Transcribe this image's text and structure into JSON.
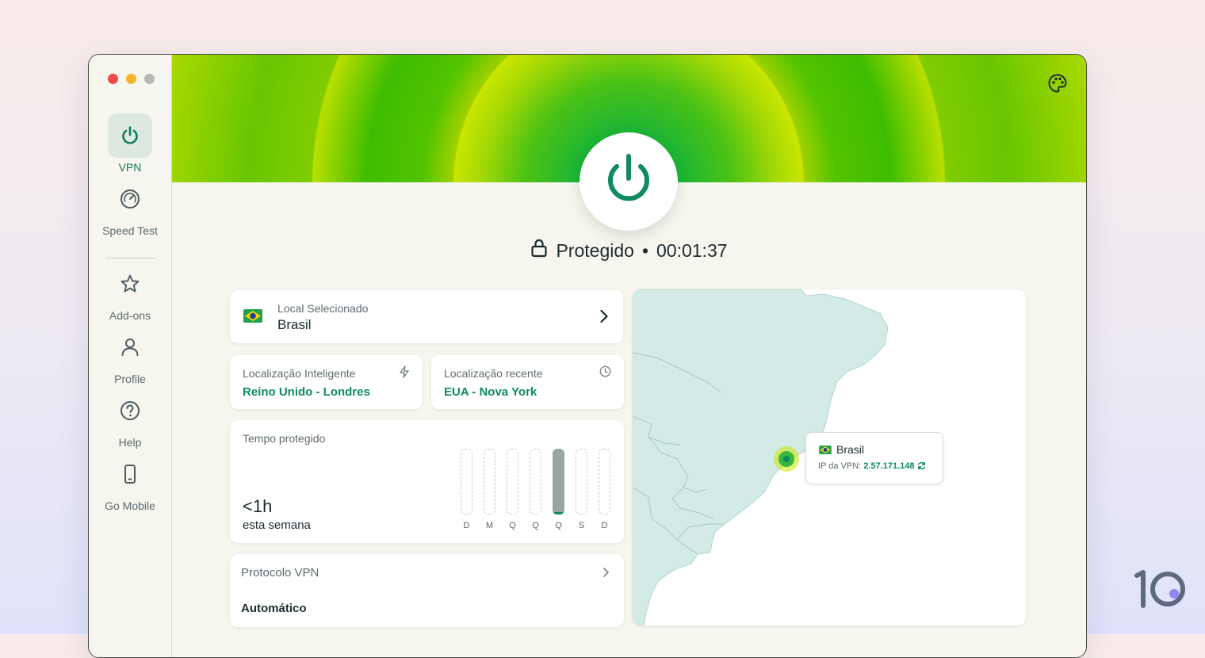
{
  "sidebar": {
    "items": [
      {
        "label": "VPN",
        "icon": "power-icon",
        "active": true
      },
      {
        "label": "Speed Test",
        "icon": "speedometer-icon"
      },
      {
        "label": "Add-ons",
        "icon": "star-icon"
      },
      {
        "label": "Profile",
        "icon": "user-icon"
      },
      {
        "label": "Help",
        "icon": "question-icon"
      },
      {
        "label": "Go Mobile",
        "icon": "phone-icon"
      }
    ]
  },
  "status": {
    "label": "Protegido",
    "separator": "•",
    "timer": "00:01:37"
  },
  "selected_location": {
    "caption": "Local Selecionado",
    "value": "Brasil",
    "flag": "brazil-flag"
  },
  "smart_location": {
    "caption": "Localização Inteligente",
    "value": "Reino Unido - Londres"
  },
  "recent_location": {
    "caption": "Localização recente",
    "value": "EUA - Nova York"
  },
  "protected_time": {
    "caption": "Tempo protegido",
    "value": "<1h",
    "period": "esta semana",
    "days": [
      "D",
      "M",
      "Q",
      "Q",
      "Q",
      "S",
      "D"
    ],
    "active_day_index": 4
  },
  "protocol": {
    "caption": "Protocolo VPN",
    "value": "Automático"
  },
  "map_popup": {
    "country": "Brasil",
    "ip_label": "IP da VPN:",
    "ip": "2.57.171.148"
  },
  "colors": {
    "accent": "#0f8a62",
    "hero_green": "#3ebd00",
    "hero_lime": "#c9e600",
    "map_land": "#d3ebe6"
  },
  "brand_logo": "10"
}
